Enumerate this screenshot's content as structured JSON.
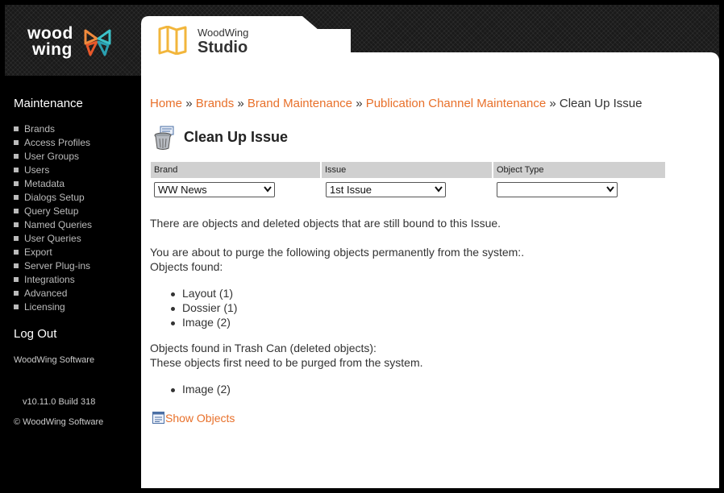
{
  "header": {
    "logo_line1": "wood",
    "logo_line2": "wing",
    "product_top": "WoodWing",
    "product_bottom": "Studio"
  },
  "sidebar": {
    "title": "Maintenance",
    "items": [
      {
        "label": "Brands"
      },
      {
        "label": "Access Profiles"
      },
      {
        "label": "User Groups"
      },
      {
        "label": "Users"
      },
      {
        "label": "Metadata"
      },
      {
        "label": "Dialogs Setup"
      },
      {
        "label": "Query Setup"
      },
      {
        "label": "Named Queries"
      },
      {
        "label": "User Queries"
      },
      {
        "label": "Export"
      },
      {
        "label": "Server Plug-ins"
      },
      {
        "label": "Integrations"
      },
      {
        "label": "Advanced"
      },
      {
        "label": "Licensing"
      }
    ],
    "logout": "Log Out",
    "company": "WoodWing Software",
    "version": "v10.11.0 Build 318",
    "copyright": "© WoodWing Software"
  },
  "breadcrumb": {
    "home": "Home",
    "brands": "Brands",
    "brand_maintenance": "Brand Maintenance",
    "channel_maintenance": "Publication Channel Maintenance",
    "current": "Clean Up Issue",
    "sep": "»"
  },
  "page": {
    "title": "Clean Up Issue"
  },
  "filters": {
    "brand_label": "Brand",
    "brand_value": "WW News",
    "issue_label": "Issue",
    "issue_value": "1st Issue",
    "object_type_label": "Object Type",
    "object_type_value": ""
  },
  "content": {
    "bound_msg": "There are objects and deleted objects that are still bound to this Issue.",
    "purge_msg": "You are about to purge the following objects permanently from the system:.",
    "objects_found": "Objects found:",
    "objects": [
      "Layout (1)",
      "Dossier (1)",
      "Image (2)"
    ],
    "trash_found": "Objects found in Trash Can (deleted objects):",
    "trash_note": "These objects first need to be purged from the system.",
    "trash_objects": [
      "Image (2)"
    ],
    "show_objects": "Show Objects"
  },
  "colors": {
    "accent": "#e8702a",
    "logo_orange": "#f08a3c",
    "logo_teal": "#3cc1c8",
    "studio_yellow": "#f2b63c"
  }
}
